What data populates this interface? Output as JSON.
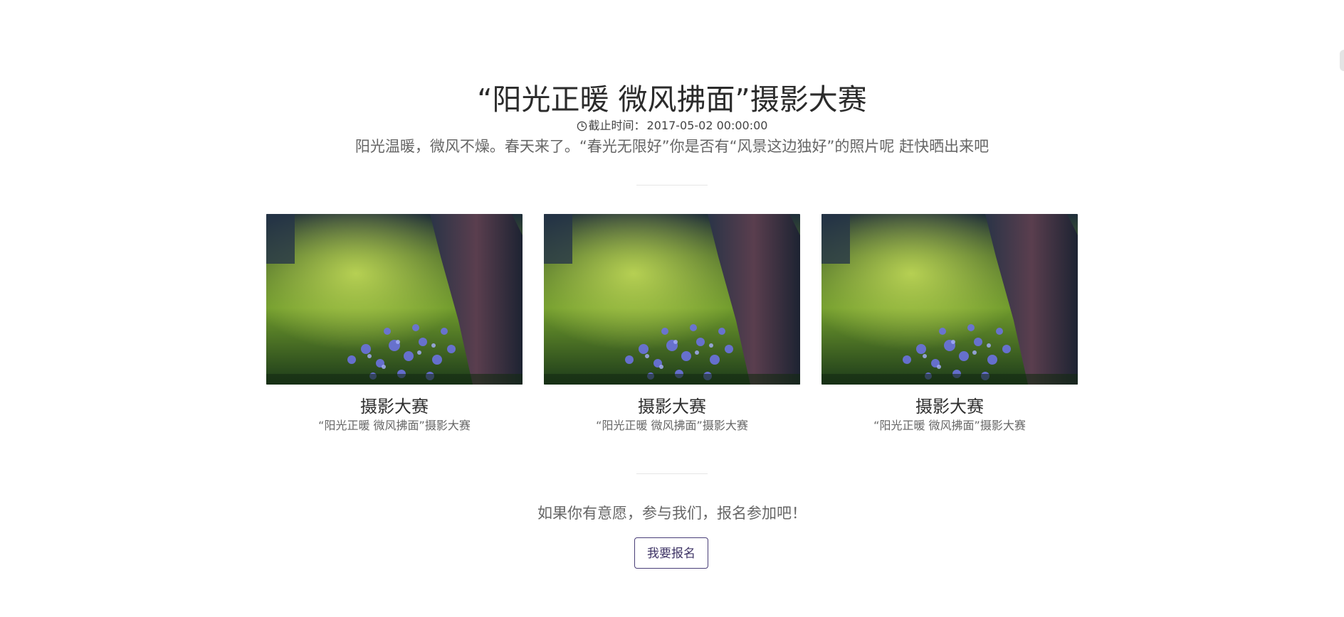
{
  "header": {
    "title": "“阳光正暖 微风拂面”摄影大赛",
    "deadline_label": "截止时间：",
    "deadline_value": "2017-05-02 00:00:00",
    "intro": "阳光温暖，微风不燥。春天来了。“春光无限好”你是否有“风景这边独好”的照片呢 赶快晒出来吧"
  },
  "icons": {
    "deadline": "clock-icon"
  },
  "gallery": [
    {
      "title": "摄影大赛",
      "subtitle": "“阳光正暖 微风拂面”摄影大赛",
      "image": "spring-flowers-tree-photo"
    },
    {
      "title": "摄影大赛",
      "subtitle": "“阳光正暖 微风拂面”摄影大赛",
      "image": "spring-flowers-tree-photo"
    },
    {
      "title": "摄影大赛",
      "subtitle": "“阳光正暖 微风拂面”摄影大赛",
      "image": "spring-flowers-tree-photo"
    }
  ],
  "cta": {
    "text": "如果你有意愿，参与我们，报名参加吧！",
    "button_label": "我要报名"
  },
  "colors": {
    "button_border": "#4a3f78",
    "title_text": "#2b2b2b",
    "muted_text": "#666666"
  }
}
